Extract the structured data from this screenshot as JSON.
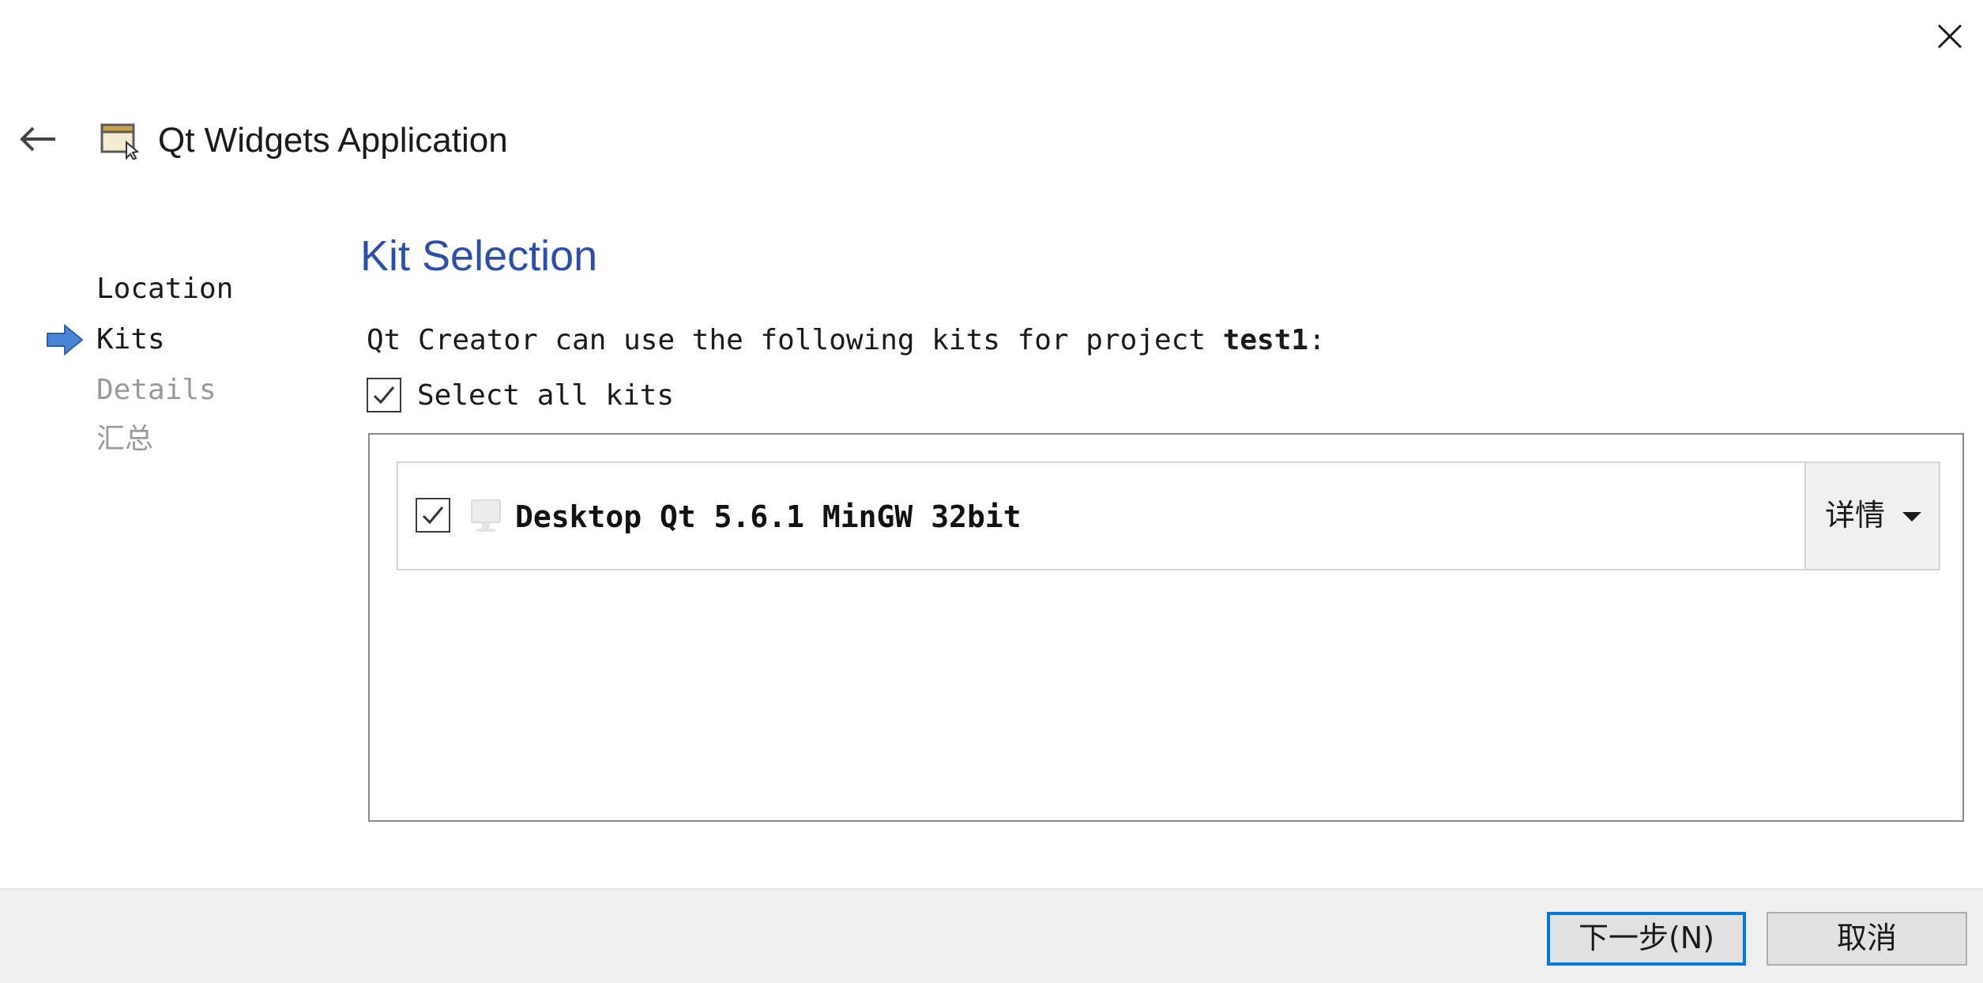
{
  "window": {
    "close_icon": "close-icon",
    "back_icon": "back-arrow-icon"
  },
  "header": {
    "icon": "application-window-icon",
    "title": "Qt Widgets Application"
  },
  "steps": [
    {
      "label": "Location",
      "state": "done"
    },
    {
      "label": "Kits",
      "state": "current"
    },
    {
      "label": "Details",
      "state": "pending"
    },
    {
      "label": "汇总",
      "state": "pending"
    }
  ],
  "main": {
    "section_title": "Kit Selection",
    "intro_prefix": "Qt Creator can use the following kits for project ",
    "project_name": "test1",
    "intro_suffix": ":",
    "select_all": {
      "label": "Select all kits",
      "checked": true
    },
    "kits": [
      {
        "label": "Desktop Qt 5.6.1 MinGW 32bit",
        "checked": true,
        "icon": "desktop-monitor-icon",
        "details_label": "详情"
      }
    ]
  },
  "footer": {
    "next_label": "下一步(N)",
    "cancel_label": "取消"
  },
  "colors": {
    "accent": "#2c4fa6",
    "step_arrow": "#4a86d8",
    "primary_border": "#0078d7",
    "pending_text": "#9a9a9a"
  }
}
